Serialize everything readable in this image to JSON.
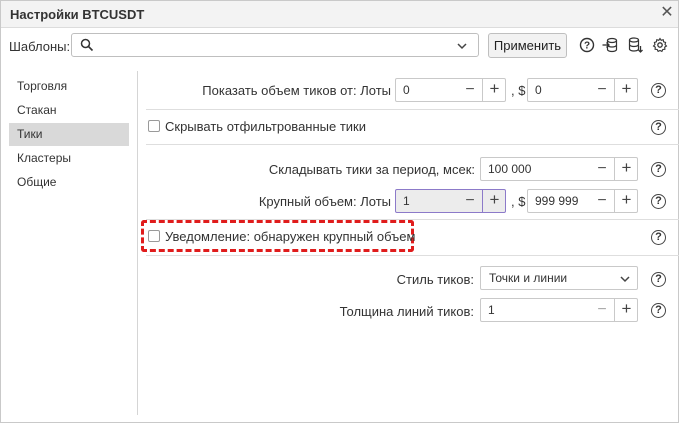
{
  "window": {
    "title": "Настройки BTCUSDT",
    "close_icon": "close-icon"
  },
  "toolbar": {
    "templates_label": "Шаблоны:",
    "templates_value": "",
    "apply_label": "Применить",
    "icons": [
      "help-icon",
      "import-icon",
      "export-icon",
      "settings-icon"
    ]
  },
  "sidebar": {
    "items": [
      {
        "label": "Торговля",
        "active": false
      },
      {
        "label": "Стакан",
        "active": false
      },
      {
        "label": "Тики",
        "active": true
      },
      {
        "label": "Кластеры",
        "active": false
      },
      {
        "label": "Общие",
        "active": false
      }
    ]
  },
  "main": {
    "show_volume": {
      "label": "Показать объем тиков от: Лоты",
      "lots_value": "0",
      "sep": ", $",
      "usd_value": "0"
    },
    "hide_filtered": {
      "label": "Скрывать отфильтрованные тики",
      "checked": false
    },
    "aggregate": {
      "label": "Складывать тики за период, мсек:",
      "value": "100 000"
    },
    "large_volume": {
      "label": "Крупный объем: Лоты",
      "lots_value": "1",
      "sep": ", $",
      "usd_value": "999 999"
    },
    "notify": {
      "label": "Уведомление: обнаружен крупный объем",
      "checked": false
    },
    "tick_style": {
      "label": "Стиль тиков:",
      "value": "Точки и линии"
    },
    "line_width": {
      "label": "Толщина линий тиков:",
      "value": "1"
    }
  },
  "colors": {
    "highlight_border": "#e01c1c",
    "active_sidebar": "#d9d9d9",
    "focused_field_border": "#8c7ac9"
  }
}
